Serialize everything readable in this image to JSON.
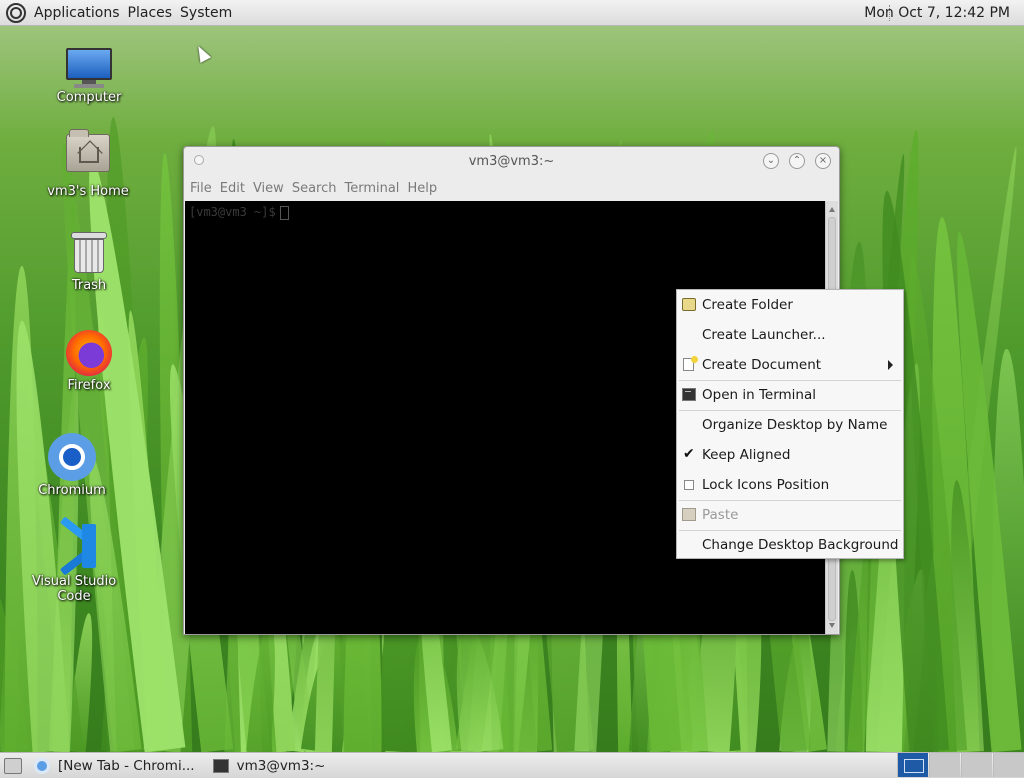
{
  "top_panel": {
    "menus": [
      "Applications",
      "Places",
      "System"
    ],
    "clock": "Mon Oct  7, 12:42 PM"
  },
  "desktop_icons": [
    {
      "label": "Computer",
      "icon": "computer-icon"
    },
    {
      "label": "vm3's Home",
      "icon": "home-folder-icon"
    },
    {
      "label": "Trash",
      "icon": "trash-icon"
    },
    {
      "label": "Firefox",
      "icon": "firefox-icon"
    },
    {
      "label": "Chromium",
      "icon": "chromium-icon"
    },
    {
      "label": "Visual Studio Code",
      "icon": "vscode-icon"
    }
  ],
  "terminal": {
    "title": "vm3@vm3:~",
    "menus": [
      "File",
      "Edit",
      "View",
      "Search",
      "Terminal",
      "Help"
    ],
    "prompt": "[vm3@vm3 ~]$"
  },
  "context_menu": {
    "items": [
      {
        "label": "Create Folder",
        "icon": "folder-icon",
        "enabled": true
      },
      {
        "label": "Create Launcher...",
        "icon": "",
        "enabled": true
      },
      {
        "label": "Create Document",
        "icon": "document-icon",
        "enabled": true,
        "submenu": true
      },
      {
        "label": "Open in Terminal",
        "icon": "terminal-icon",
        "enabled": true
      },
      {
        "label": "Organize Desktop by Name",
        "icon": "",
        "enabled": true
      },
      {
        "label": "Keep Aligned",
        "icon": "checkmark-icon",
        "enabled": true,
        "checked": true
      },
      {
        "label": "Lock Icons Position",
        "icon": "checkbox-icon",
        "enabled": true,
        "checked": false
      },
      {
        "label": "Paste",
        "icon": "paste-icon",
        "enabled": false
      },
      {
        "label": "Change Desktop Background",
        "icon": "",
        "enabled": true
      }
    ]
  },
  "taskbar": {
    "tasks": [
      {
        "label": "[New Tab - Chromi...",
        "icon": "chromium-icon"
      },
      {
        "label": "vm3@vm3:~",
        "icon": "terminal-icon"
      }
    ],
    "workspaces": 4,
    "active_workspace": 1
  },
  "colors": {
    "workspace_active": "#1f5aa6",
    "terminal_bg": "#000000",
    "menu_bg": "#f7f7f7"
  }
}
